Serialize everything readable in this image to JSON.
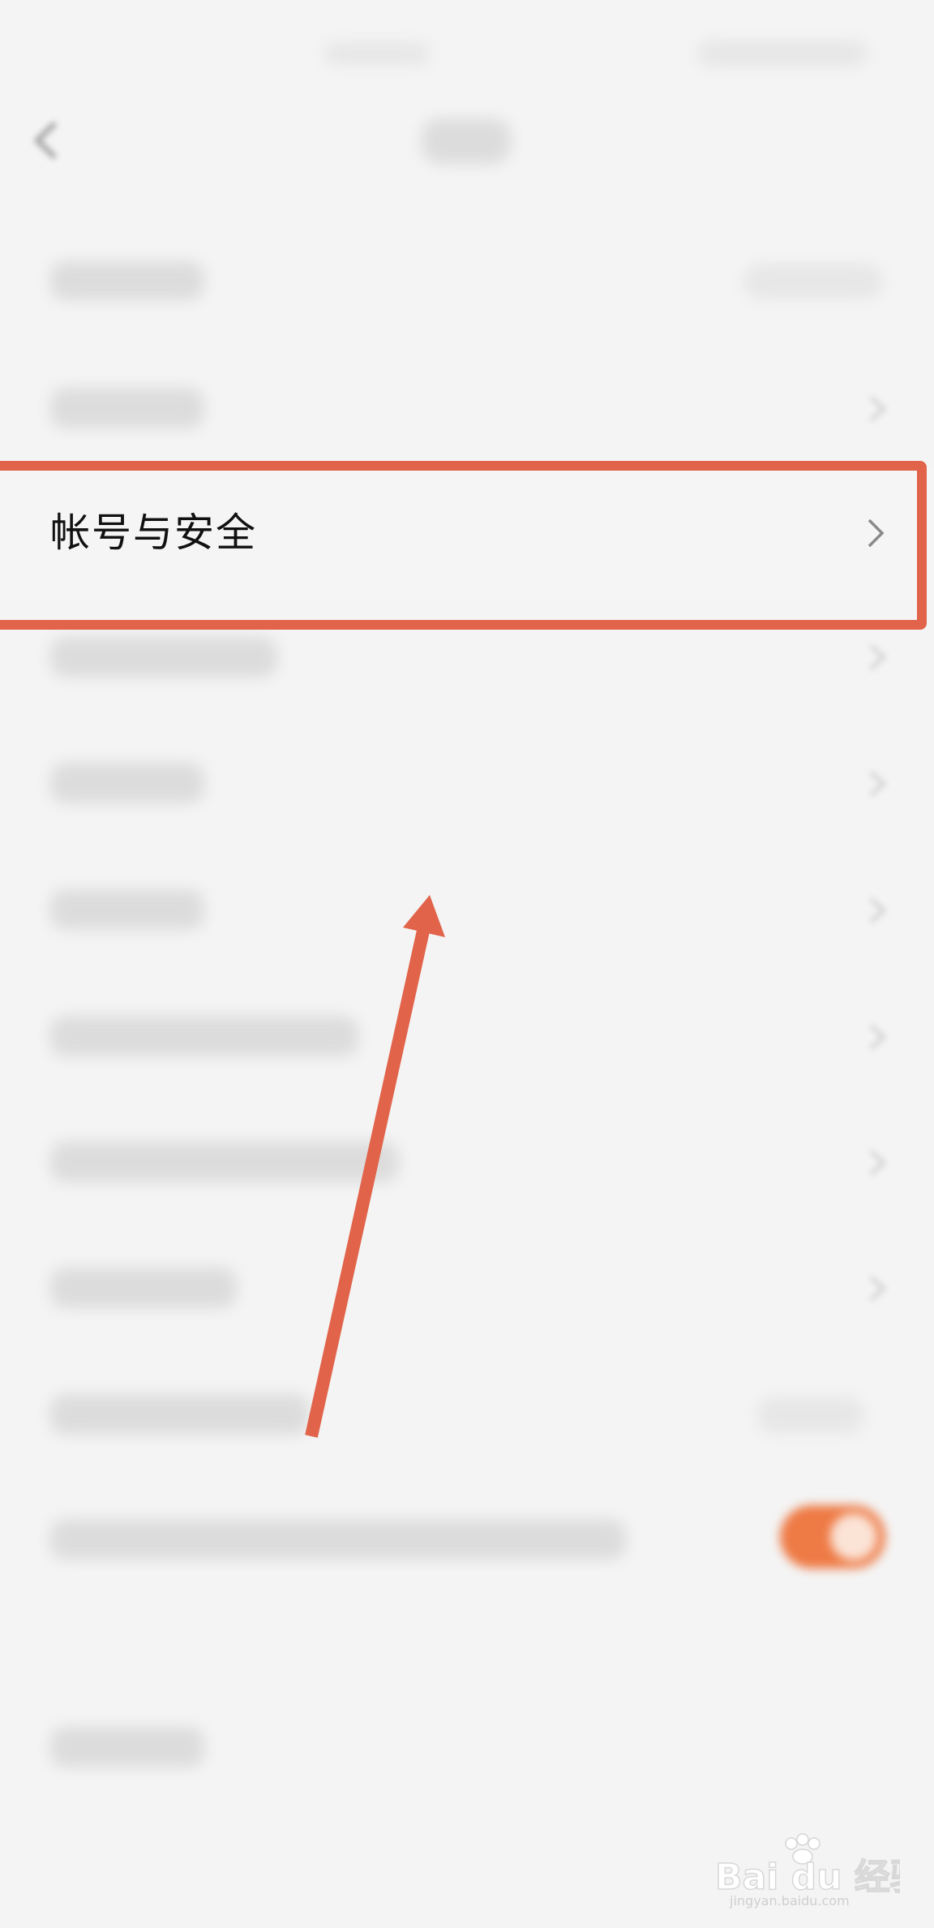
{
  "settings": {
    "highlighted_item": {
      "label": "帐号与安全"
    }
  },
  "annotation": {
    "highlight_color": "#e1634a",
    "arrow_color": "#e1634a"
  },
  "colors": {
    "background": "#f4f4f4",
    "toggle_on": "#ee7a45"
  },
  "watermark": {
    "brand": "Bai du 经验",
    "url": "jingyan.baidu.com"
  },
  "icons": [
    "back-arrow-icon",
    "chevron-right-icon",
    "toggle-switch-icon",
    "baidu-paw-icon"
  ]
}
